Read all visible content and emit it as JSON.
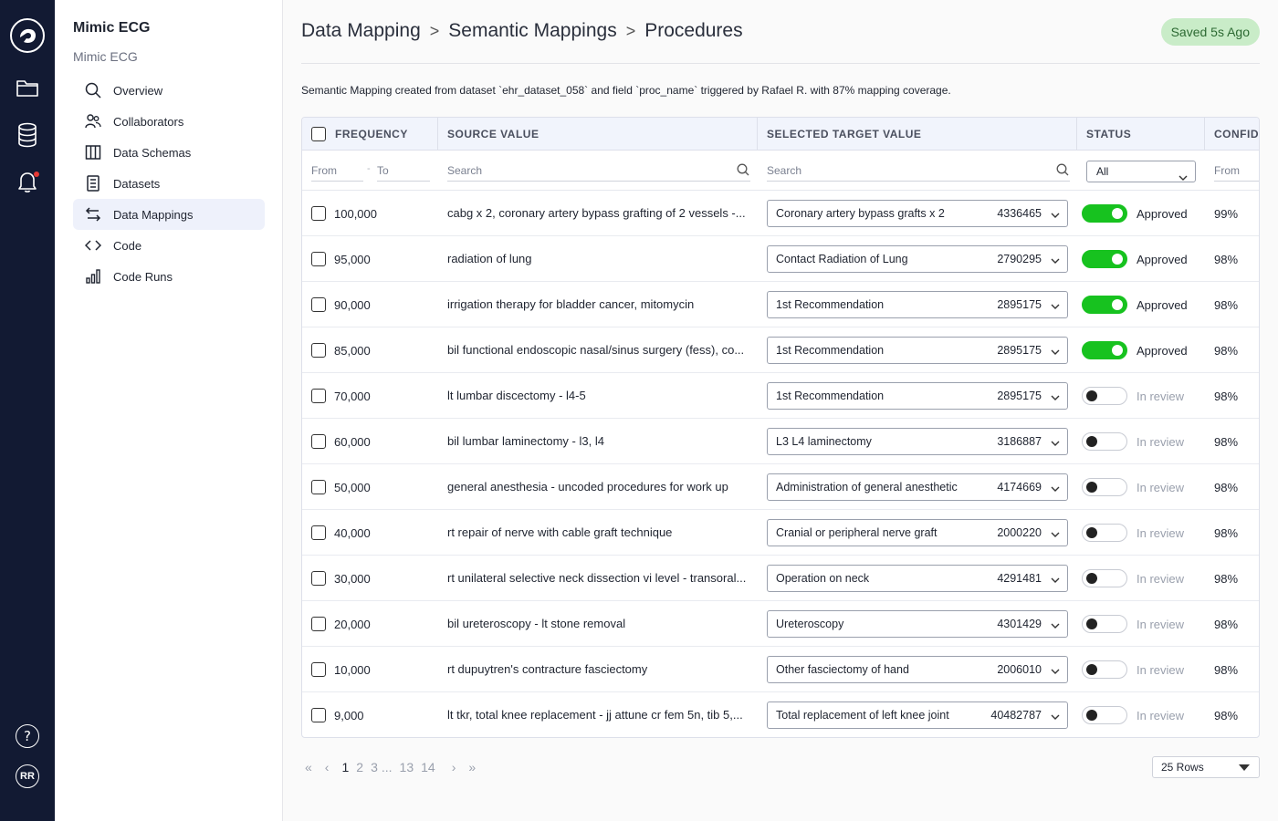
{
  "sidebar": {
    "project_title": "Mimic ECG",
    "project_subtitle": "Mimic ECG",
    "items": [
      {
        "label": "Overview",
        "icon": "search-icon"
      },
      {
        "label": "Collaborators",
        "icon": "users-icon"
      },
      {
        "label": "Data Schemas",
        "icon": "columns-icon"
      },
      {
        "label": "Datasets",
        "icon": "dataset-icon"
      },
      {
        "label": "Data Mappings",
        "icon": "swap-arrows-icon",
        "active": true
      },
      {
        "label": "Code",
        "icon": "code-icon"
      },
      {
        "label": "Code Runs",
        "icon": "bar-chart-icon"
      }
    ]
  },
  "rail": {
    "avatar_initials": "RR",
    "help_label": "?"
  },
  "header": {
    "breadcrumbs": [
      "Data Mapping",
      "Semantic Mappings",
      "Procedures"
    ],
    "separator": ">",
    "saved_badge": "Saved 5s Ago",
    "description": "Semantic Mapping created from dataset `ehr_dataset_058` and field `proc_name` triggered by Rafael R. with 87% mapping coverage."
  },
  "table": {
    "columns": [
      "FREQUENCY",
      "SOURCE VALUE",
      "SELECTED TARGET VALUE",
      "STATUS",
      "CONFIDE"
    ],
    "filters": {
      "freq_from": "From",
      "freq_sep": "-",
      "freq_to": "To",
      "source_search": "Search",
      "target_search": "Search",
      "status_select": "All",
      "conf_from": "From",
      "conf_sep": "-"
    },
    "rows": [
      {
        "frequency": "100,000",
        "source": "cabg x 2, coronary artery bypass grafting of 2 vessels -...",
        "target": "Coronary artery bypass grafts x 2",
        "code": "4336465",
        "approved": true,
        "status": "Approved",
        "confidence": "99%"
      },
      {
        "frequency": "95,000",
        "source": "radiation of lung",
        "target": "Contact Radiation of Lung",
        "code": "2790295",
        "approved": true,
        "status": "Approved",
        "confidence": "98%"
      },
      {
        "frequency": "90,000",
        "source": "irrigation therapy for bladder cancer, mitomycin",
        "target": "1st Recommendation",
        "code": "2895175",
        "approved": true,
        "status": "Approved",
        "confidence": "98%"
      },
      {
        "frequency": "85,000",
        "source": "bil functional endoscopic nasal/sinus surgery (fess), co...",
        "target": "1st Recommendation",
        "code": "2895175",
        "approved": true,
        "status": "Approved",
        "confidence": "98%"
      },
      {
        "frequency": "70,000",
        "source": "lt lumbar discectomy   - l4-5",
        "target": "1st Recommendation",
        "code": "2895175",
        "approved": false,
        "status": "In review",
        "confidence": "98%"
      },
      {
        "frequency": "60,000",
        "source": "bil lumbar laminectomy   - l3, l4",
        "target": "L3 L4 laminectomy",
        "code": "3186887",
        "approved": false,
        "status": "In review",
        "confidence": "98%"
      },
      {
        "frequency": "50,000",
        "source": "general anesthesia - uncoded procedures for work up",
        "target": "Administration of general anesthetic",
        "code": "4174669",
        "approved": false,
        "status": "In review",
        "confidence": "98%"
      },
      {
        "frequency": "40,000",
        "source": "rt repair of nerve with cable graft technique",
        "target": "Cranial or peripheral nerve graft",
        "code": "2000220",
        "approved": false,
        "status": "In review",
        "confidence": "98%"
      },
      {
        "frequency": "30,000",
        "source": "rt unilateral selective neck dissection vi level   - transoral...",
        "target": "Operation on neck",
        "code": "4291481",
        "approved": false,
        "status": "In review",
        "confidence": "98%"
      },
      {
        "frequency": "20,000",
        "source": "bil ureteroscopy   - lt stone removal",
        "target": "Ureteroscopy",
        "code": "4301429",
        "approved": false,
        "status": "In review",
        "confidence": "98%"
      },
      {
        "frequency": "10,000",
        "source": "rt dupuytren's contracture fasciectomy",
        "target": "Other fasciectomy of hand",
        "code": "2006010",
        "approved": false,
        "status": "In review",
        "confidence": "98%"
      },
      {
        "frequency": "9,000",
        "source": "lt tkr, total knee replacement   - jj attune cr fem 5n, tib 5,...",
        "target": "Total replacement of left knee joint",
        "code": "40482787",
        "approved": false,
        "status": "In review",
        "confidence": "98%"
      }
    ]
  },
  "pagination": {
    "first": "«",
    "prev": "‹",
    "pages": [
      "1",
      "2",
      "3",
      "...",
      "13",
      "14"
    ],
    "current": "1",
    "next": "›",
    "last": "»",
    "rows_per_page": "25 Rows"
  },
  "colors": {
    "rail_bg": "#121a33",
    "approved_green": "#17c21f",
    "saved_badge_bg": "#c9ecc8",
    "header_bg": "#f1f4fc"
  }
}
